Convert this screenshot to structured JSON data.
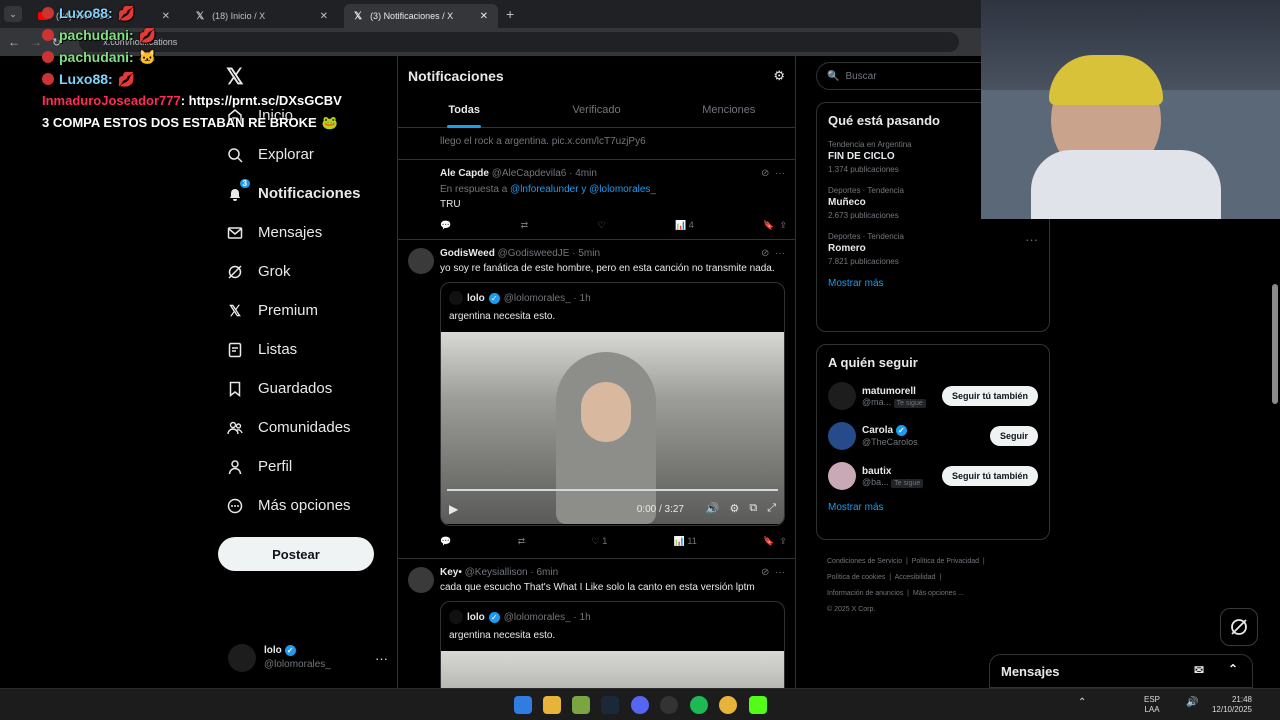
{
  "browser": {
    "tabs": [
      {
        "label": "(34) YouTube",
        "active": false
      },
      {
        "label": "(18) Inicio / X",
        "active": false
      },
      {
        "label": "(3) Notificaciones / X",
        "active": true
      }
    ],
    "url": "x.com/notifications"
  },
  "sidebar": {
    "items": [
      {
        "label": "Inicio",
        "icon": "home-icon"
      },
      {
        "label": "Explorar",
        "icon": "search-icon"
      },
      {
        "label": "Notificaciones",
        "icon": "bell-icon",
        "badge": "3",
        "active": true
      },
      {
        "label": "Mensajes",
        "icon": "mail-icon"
      },
      {
        "label": "Grok",
        "icon": "grok-icon"
      },
      {
        "label": "Premium",
        "icon": "x-logo-icon"
      },
      {
        "label": "Listas",
        "icon": "list-icon"
      },
      {
        "label": "Guardados",
        "icon": "bookmark-icon"
      },
      {
        "label": "Comunidades",
        "icon": "people-icon"
      },
      {
        "label": "Perfil",
        "icon": "person-icon"
      },
      {
        "label": "Más opciones",
        "icon": "more-circle-icon"
      }
    ],
    "post_label": "Postear",
    "account": {
      "name": "lolo",
      "handle": "@lolomorales_"
    }
  },
  "main": {
    "title": "Notificaciones",
    "tabs": [
      "Todas",
      "Verificado",
      "Menciones"
    ],
    "partial_text": "llego el rock a argentina. pic.x.com/lcT7uzjPy6",
    "tweets": [
      {
        "name": "Ale Capde",
        "meta": "@AleCapdevila6 · 4min",
        "reply_prefix": "En respuesta a",
        "reply_to": "@lnforealunder y @lolomorales_",
        "text": "TRU",
        "views": "4",
        "likes": ""
      },
      {
        "name": "GodisWeed",
        "meta": "@GodisweedJE · 5min",
        "text": "yo soy re fanática de este hombre, pero en esta canción no transmite nada.",
        "quote": {
          "name": "lolo",
          "meta": "@lolomorales_ · 1h",
          "text": "argentina necesita esto."
        },
        "video_time": "0:00 / 3:27",
        "video_progress": 0,
        "likes": "1",
        "views": "11"
      },
      {
        "name": "Key•",
        "meta": "@Keysiallison · 6min",
        "text": "cada que escucho That's What I Like solo la canto en esta versión lptm",
        "quote": {
          "name": "lolo",
          "meta": "@lolomorales_ · 1h",
          "text": "argentina necesita esto."
        }
      }
    ]
  },
  "right": {
    "search_placeholder": "Buscar",
    "trends_title": "Qué está pasando",
    "trends": [
      {
        "context": "Tendencia en Argentina",
        "title": "FIN DE CICLO",
        "count": "1.374 publicaciones"
      },
      {
        "context": "Deportes · Tendencia",
        "title": "Muñeco",
        "count": "2.673 publicaciones"
      },
      {
        "context": "Deportes · Tendencia",
        "title": "Romero",
        "count": "7.821 publicaciones"
      }
    ],
    "show_more": "Mostrar más",
    "who_title": "A quién seguir",
    "who": [
      {
        "name": "matumorell",
        "handle": "@ma...",
        "tag": "Te sigue",
        "button": "Seguir tú también"
      },
      {
        "name": "Carola",
        "handle": "@TheCarolos",
        "tag": "",
        "button": "Seguir",
        "verified": true
      },
      {
        "name": "bautix",
        "handle": "@ba...",
        "tag": "Te sigue",
        "button": "Seguir tú también"
      }
    ],
    "footer": [
      "Condiciones de Servicio",
      "Política de Privacidad",
      "Política de cookies",
      "Accesibilidad",
      "Información de anuncios",
      "Más opciones ...",
      "© 2025 X Corp."
    ],
    "messages_label": "Mensajes"
  },
  "chat_overlay": [
    {
      "user": "Luxo88:",
      "text": "",
      "color": "#7fd3ff"
    },
    {
      "user": "pachudani:",
      "text": "",
      "color": "#7fe07f"
    },
    {
      "user": "pachudani:",
      "text": "",
      "color": "#7fe07f"
    },
    {
      "user": "Luxo88:",
      "text": "",
      "color": "#7fd3ff"
    },
    {
      "user": "InmaduroJoseador777",
      "text": ": https://prnt.sc/DXsGCBV",
      "color": "#ff2d55"
    },
    {
      "user": "",
      "text": "3 COMPA ESTOS DOS ESTABAN RE BROKE",
      "color": "#ffffff"
    }
  ],
  "taskbar": {
    "lang": "ESP",
    "lang2": "LAA",
    "time": "21:48",
    "date": "12/10/2025"
  }
}
